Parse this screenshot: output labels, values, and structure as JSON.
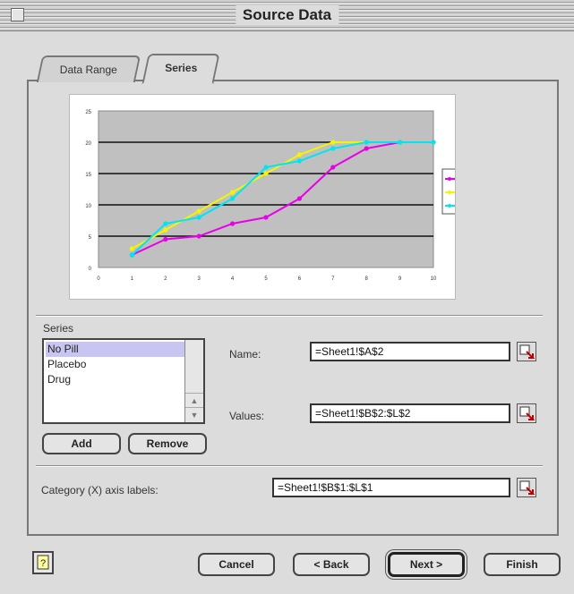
{
  "window": {
    "title": "Source Data"
  },
  "tabs": [
    {
      "label": "Data Range",
      "active": false
    },
    {
      "label": "Series",
      "active": true
    }
  ],
  "chart_data": {
    "type": "line",
    "x": [
      1,
      2,
      3,
      4,
      5,
      6,
      7,
      8,
      9,
      10
    ],
    "x_tick_labels": [
      "0",
      "1",
      "2",
      "3",
      "4",
      "5",
      "6",
      "7",
      "8",
      "9",
      "10"
    ],
    "y_tick_labels": [
      "0",
      "5",
      "10",
      "15",
      "20",
      "25"
    ],
    "ylim": [
      0,
      25
    ],
    "grid": true,
    "legend": "right",
    "series": [
      {
        "name": "No Pill",
        "color": "#e800e8",
        "values": [
          2,
          4.5,
          5,
          7,
          8,
          11,
          16,
          19,
          20,
          20
        ]
      },
      {
        "name": "Placebo",
        "color": "#f5f500",
        "values": [
          3,
          6,
          9,
          12,
          15,
          18,
          20,
          20,
          20,
          20
        ]
      },
      {
        "name": "Drug",
        "color": "#00e5f0",
        "values": [
          2,
          7,
          8,
          11,
          16,
          17,
          19,
          20,
          20,
          20
        ]
      }
    ]
  },
  "series_panel": {
    "label": "Series",
    "items": [
      "No Pill",
      "Placebo",
      "Drug"
    ],
    "selected": "No Pill",
    "add_label": "Add",
    "remove_label": "Remove"
  },
  "fields": {
    "name_label": "Name:",
    "name_value": "=Sheet1!$A$2",
    "values_label": "Values:",
    "values_value": "=Sheet1!$B$2:$L$2",
    "category_label": "Category (X) axis labels:",
    "category_value": "=Sheet1!$B$1:$L$1"
  },
  "buttons": {
    "cancel": "Cancel",
    "back": "< Back",
    "next": "Next >",
    "finish": "Finish"
  },
  "icons": {
    "close": "close-box-icon",
    "collapse": "collapse-dialog-icon",
    "help": "help-icon"
  }
}
